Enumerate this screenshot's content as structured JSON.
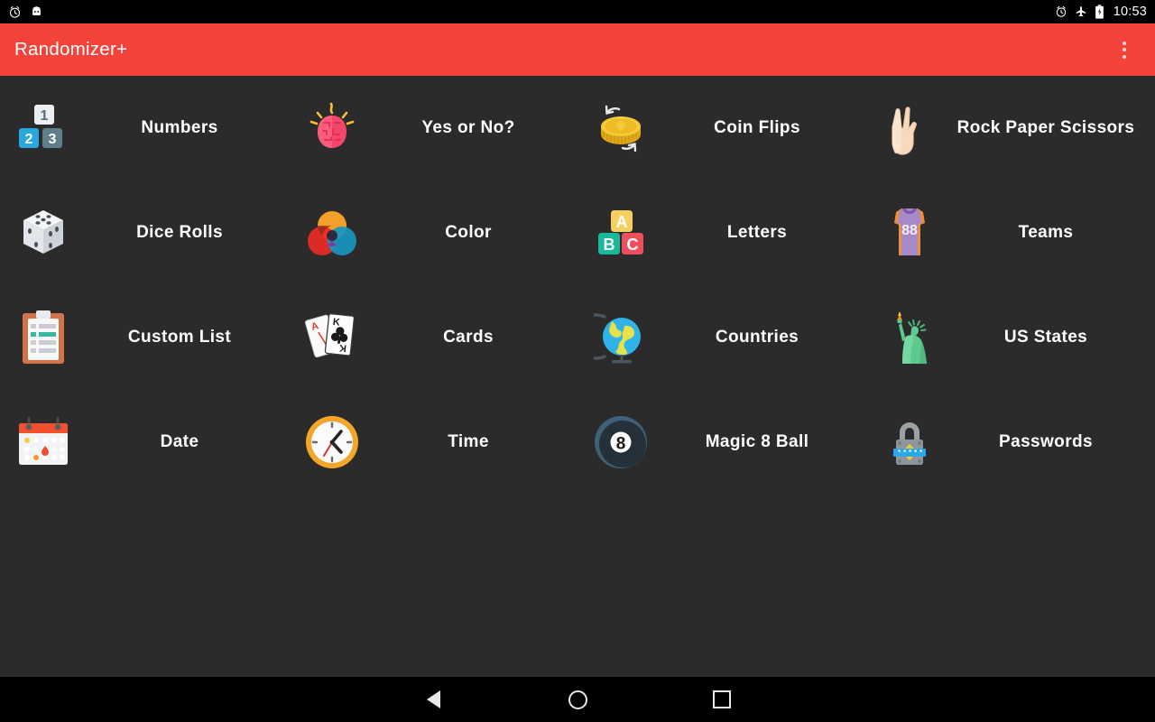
{
  "status_bar": {
    "left_icons": [
      "alarm-icon",
      "android-robot-icon"
    ],
    "right_icons": [
      "alarm-icon",
      "airplane-mode-icon",
      "battery-charging-icon"
    ],
    "time": "10:53"
  },
  "app_bar": {
    "title": "Randomizer+",
    "overflow_label": "More options",
    "background_color": "#F4433A",
    "title_color": "#FFFFFF"
  },
  "theme": {
    "background_color": "#2B2B2B",
    "label_color": "#FFFFFF",
    "nav_bar_color": "#000000"
  },
  "grid": {
    "columns": 4,
    "items": [
      {
        "label": "Numbers",
        "icon": "number-tiles-icon"
      },
      {
        "label": "Yes or No?",
        "icon": "brain-icon"
      },
      {
        "label": "Coin Flips",
        "icon": "coin-flip-icon"
      },
      {
        "label": "Rock Paper Scissors",
        "icon": "victory-hand-icon"
      },
      {
        "label": "Dice Rolls",
        "icon": "dice-icon"
      },
      {
        "label": "Color",
        "icon": "color-circles-icon"
      },
      {
        "label": "Letters",
        "icon": "abc-blocks-icon"
      },
      {
        "label": "Teams",
        "icon": "jersey-icon"
      },
      {
        "label": "Custom List",
        "icon": "clipboard-icon"
      },
      {
        "label": "Cards",
        "icon": "playing-cards-icon"
      },
      {
        "label": "Countries",
        "icon": "globe-icon"
      },
      {
        "label": "US States",
        "icon": "statue-of-liberty-icon"
      },
      {
        "label": "Date",
        "icon": "calendar-icon"
      },
      {
        "label": "Time",
        "icon": "clock-icon"
      },
      {
        "label": "Magic 8 Ball",
        "icon": "eight-ball-icon"
      },
      {
        "label": "Passwords",
        "icon": "padlock-password-icon"
      }
    ]
  },
  "nav_bar": {
    "back_label": "Back",
    "home_label": "Home",
    "recents_label": "Recents"
  }
}
